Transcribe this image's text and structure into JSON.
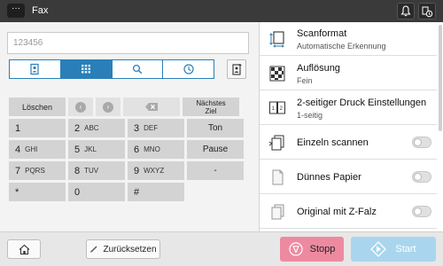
{
  "header": {
    "menu_label": "···",
    "title": "Fax",
    "icons": [
      "bell-icon",
      "status-icon"
    ]
  },
  "destination": {
    "value": "123456",
    "placeholder": ""
  },
  "tabs": [
    {
      "icon": "addressbook-icon",
      "active": false
    },
    {
      "icon": "keypad-icon",
      "active": true
    },
    {
      "icon": "search-icon",
      "active": false
    },
    {
      "icon": "history-icon",
      "active": false
    }
  ],
  "keypad": {
    "clear_label": "Löschen",
    "next_dest_line1": "Nächstes",
    "next_dest_line2": "Ziel",
    "keys": [
      {
        "num": "1",
        "letters": ""
      },
      {
        "num": "2",
        "letters": "ABC"
      },
      {
        "num": "3",
        "letters": "DEF"
      },
      {
        "num": "4",
        "letters": "GHI"
      },
      {
        "num": "5",
        "letters": "JKL"
      },
      {
        "num": "6",
        "letters": "MNO"
      },
      {
        "num": "7",
        "letters": "PQRS"
      },
      {
        "num": "8",
        "letters": "TUV"
      },
      {
        "num": "9",
        "letters": "WXYZ"
      },
      {
        "num": "*",
        "letters": ""
      },
      {
        "num": "0",
        "letters": ""
      },
      {
        "num": "#",
        "letters": ""
      }
    ],
    "ton_label": "Ton",
    "pause_label": "Pause",
    "dash_label": "-"
  },
  "settings": [
    {
      "icon": "scanformat-icon",
      "title": "Scanformat",
      "value": "Automatische  Erkennung"
    },
    {
      "icon": "resolution-icon",
      "title": "Auflösung",
      "value": "Fein"
    },
    {
      "icon": "duplex-icon",
      "title": "2-seitiger  Druck  Einstellungen",
      "value": "1-seitig"
    },
    {
      "icon": "single-scan-icon",
      "title": "Einzeln  scannen",
      "toggle": false
    },
    {
      "icon": "thin-paper-icon",
      "title": "Dünnes  Papier",
      "toggle": false
    },
    {
      "icon": "z-fold-icon",
      "title": "Original  mit  Z-Falz",
      "toggle": false
    }
  ],
  "bottom": {
    "reset_label": "Zurücksetzen",
    "stop_label": "Stopp",
    "start_label": "Start"
  },
  "colors": {
    "accent": "#2a7fb8",
    "stop": "#ee8aa0",
    "start": "#a9d6ee",
    "header": "#3a3a3a"
  }
}
